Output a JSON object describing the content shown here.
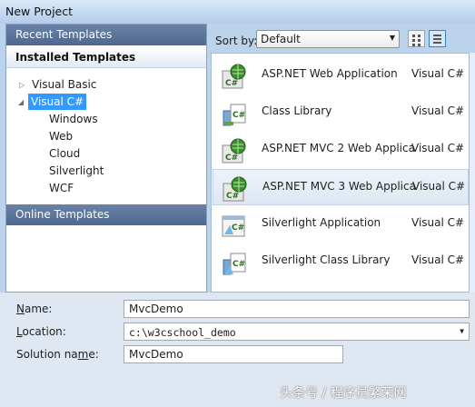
{
  "window": {
    "title": "New Project"
  },
  "sidebar": {
    "recent_templates": "Recent Templates",
    "installed_templates": "Installed Templates",
    "tree": [
      {
        "label": "Visual Basic",
        "expander": "▷"
      },
      {
        "label": "Visual C#",
        "expander": "◢",
        "selected": true
      },
      {
        "label": "Windows"
      },
      {
        "label": "Web"
      },
      {
        "label": "Cloud"
      },
      {
        "label": "Silverlight"
      },
      {
        "label": "WCF"
      }
    ],
    "online_templates": "Online Templates"
  },
  "sort": {
    "label": "Sort by:",
    "value": "Default",
    "arrow": "▼"
  },
  "templates": [
    {
      "name": "ASP.NET Web Application",
      "language": "Visual C#",
      "icon": "web-app-csharp-icon"
    },
    {
      "name": "Class Library",
      "language": "Visual C#",
      "icon": "class-library-csharp-icon"
    },
    {
      "name": "ASP.NET MVC 2 Web Applica...",
      "language": "Visual C#",
      "icon": "mvc2-web-app-csharp-icon"
    },
    {
      "name": "ASP.NET MVC 3 Web Applica...",
      "language": "Visual C#",
      "icon": "mvc3-web-app-csharp-icon",
      "selected": true
    },
    {
      "name": "Silverlight Application",
      "language": "Visual C#",
      "icon": "silverlight-app-csharp-icon"
    },
    {
      "name": "Silverlight Class Library",
      "language": "Visual C#",
      "icon": "silverlight-library-csharp-icon"
    }
  ],
  "form": {
    "name_label_pre": "N",
    "name_label_post": "ame:",
    "name_value": "MvcDemo",
    "location_label_pre": "L",
    "location_label_post": "ocation:",
    "location_value": "c:\\w3cschool_demo",
    "location_arrow": "▼",
    "solution_label_pre": "Solution na",
    "solution_label_u": "m",
    "solution_label_post": "e:",
    "solution_value": "MvcDemo"
  },
  "watermark": "头条号 / 程序员繁荣网",
  "colors": {
    "selection": "#3399ff",
    "header": "#5a7399",
    "form_bg": "#dfe7f2",
    "title_bar": "#c2d8f1"
  }
}
